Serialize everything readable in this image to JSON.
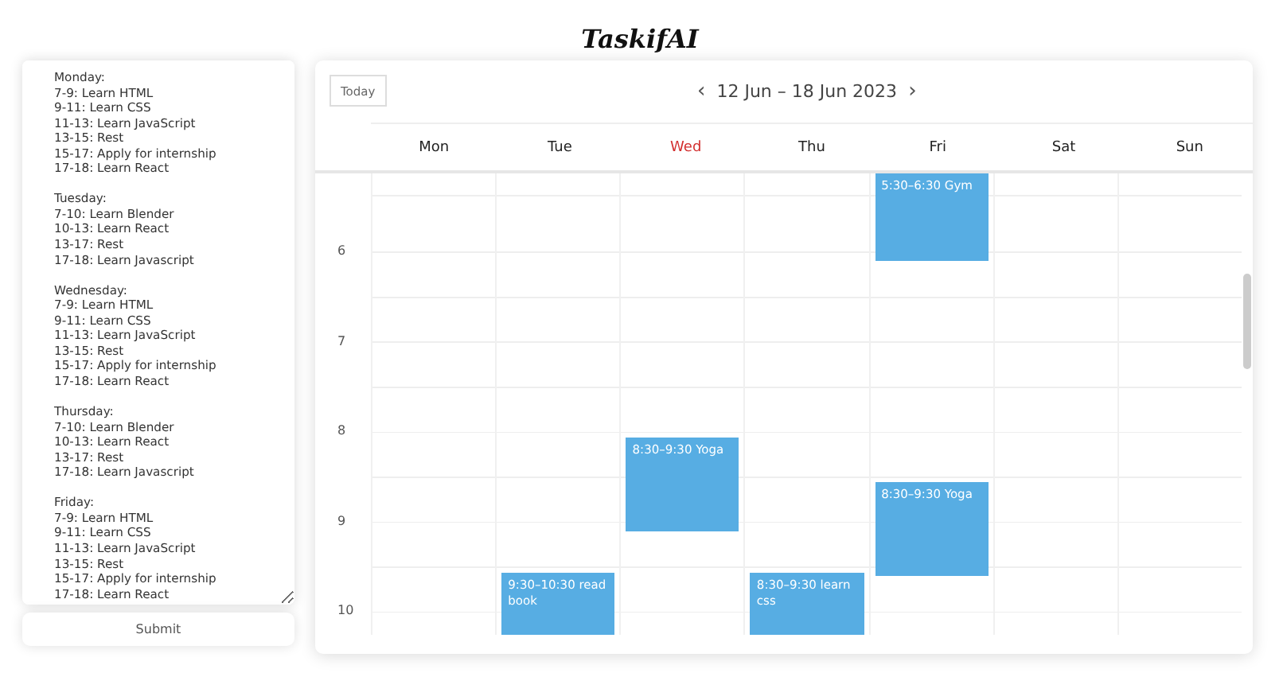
{
  "app_title": "TaskifAI",
  "schedule": {
    "value": "Monday:\n7-9: Learn HTML\n9-11: Learn CSS\n11-13: Learn JavaScript\n13-15: Rest\n15-17: Apply for internship\n17-18: Learn React\n\nTuesday:\n7-10: Learn Blender\n10-13: Learn React\n13-17: Rest\n17-18: Learn Javascript\n\nWednesday:\n7-9: Learn HTML\n9-11: Learn CSS\n11-13: Learn JavaScript\n13-15: Rest\n15-17: Apply for internship\n17-18: Learn React\n\nThursday:\n7-10: Learn Blender\n10-13: Learn React\n13-17: Rest\n17-18: Learn Javascript\n\nFriday:\n7-9: Learn HTML\n9-11: Learn CSS\n11-13: Learn JavaScript\n13-15: Rest\n15-17: Apply for internship\n17-18: Learn React"
  },
  "submit_button": "Submit",
  "calendar": {
    "today_button": "Today",
    "prev": "‹",
    "range": "12 Jun – 18 Jun 2023",
    "next": "›",
    "hours": [
      "6",
      "7",
      "8",
      "9",
      "10"
    ],
    "days": [
      {
        "label": "Mon",
        "today": false
      },
      {
        "label": "Tue",
        "today": false,
        "events": [
          {
            "label": "9:30–10:30 read book"
          }
        ]
      },
      {
        "label": "Wed",
        "today": true,
        "events": [
          {
            "label": "8:30–9:30 Yoga"
          }
        ]
      },
      {
        "label": "Thu",
        "today": false,
        "events": [
          {
            "label": "8:30–9:30 learn css"
          }
        ]
      },
      {
        "label": "Fri",
        "today": false,
        "events": [
          {
            "label": "5:30–6:30 Gym"
          },
          {
            "label": "8:30–9:30 Yoga"
          }
        ]
      },
      {
        "label": "Sat",
        "today": false
      },
      {
        "label": "Sun",
        "today": false
      }
    ]
  }
}
